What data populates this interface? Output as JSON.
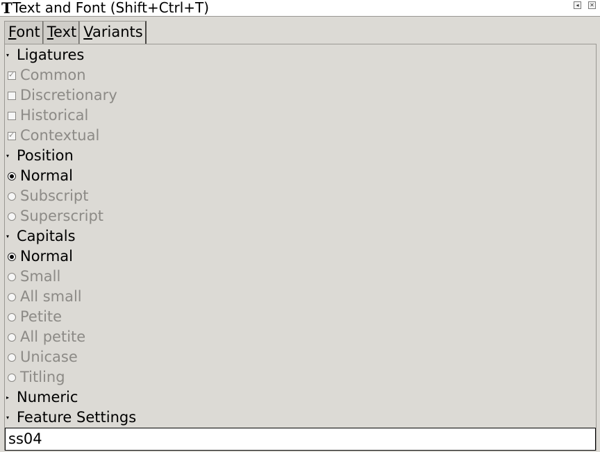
{
  "window": {
    "title_icon": "T",
    "title": "Text and Font (Shift+Ctrl+T)",
    "iconify_glyph": "◂",
    "close_glyph": "✕"
  },
  "tabs": [
    {
      "first": "F",
      "rest": "ont"
    },
    {
      "first": "T",
      "rest": "ext"
    },
    {
      "first": "V",
      "rest": "ariants"
    }
  ],
  "sections": {
    "ligatures": {
      "arrow": "▾",
      "label": "Ligatures",
      "items": [
        {
          "label": "Common",
          "checked": true
        },
        {
          "label": "Discretionary",
          "checked": false
        },
        {
          "label": "Historical",
          "checked": false
        },
        {
          "label": "Contextual",
          "checked": true
        }
      ]
    },
    "position": {
      "arrow": "▾",
      "label": "Position",
      "items": [
        {
          "label": "Normal",
          "selected": true
        },
        {
          "label": "Subscript",
          "selected": false
        },
        {
          "label": "Superscript",
          "selected": false
        }
      ]
    },
    "capitals": {
      "arrow": "▾",
      "label": "Capitals",
      "items": [
        {
          "label": "Normal",
          "selected": true
        },
        {
          "label": "Small",
          "selected": false
        },
        {
          "label": "All small",
          "selected": false
        },
        {
          "label": "Petite",
          "selected": false
        },
        {
          "label": "All petite",
          "selected": false
        },
        {
          "label": "Unicase",
          "selected": false
        },
        {
          "label": "Titling",
          "selected": false
        }
      ]
    },
    "numeric": {
      "arrow": "▸",
      "label": "Numeric"
    },
    "feature_settings": {
      "arrow": "▾",
      "label": "Feature Settings",
      "value": "ss04"
    }
  }
}
